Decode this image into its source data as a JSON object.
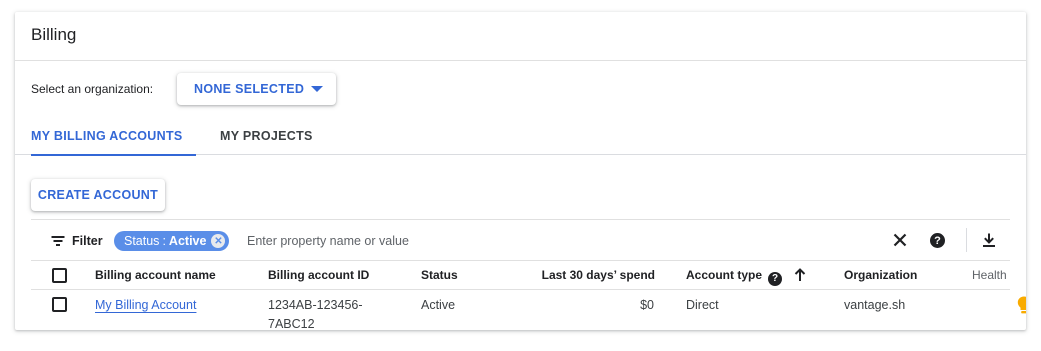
{
  "header": {
    "title": "Billing"
  },
  "org_select": {
    "label": "Select an organization:",
    "value": "NONE SELECTED"
  },
  "tabs": [
    {
      "label": "MY BILLING ACCOUNTS",
      "active": true
    },
    {
      "label": "MY PROJECTS",
      "active": false
    }
  ],
  "create_button": {
    "label": "CREATE ACCOUNT"
  },
  "filter": {
    "label": "Filter",
    "chip": {
      "key": "Status",
      "separator": ":",
      "value": "Active"
    },
    "placeholder": "Enter property name or value"
  },
  "table": {
    "columns": [
      "Billing account name",
      "Billing account ID",
      "Status",
      "Last 30 days’ spend",
      "Account type",
      "Organization",
      "Health"
    ],
    "rows": [
      {
        "name": "My Billing Account",
        "id_line1": "1234AB-123456-",
        "id_line2": "7ABC12",
        "status": "Active",
        "spend": "$0",
        "account_type": "Direct",
        "organization": "vantage.sh"
      }
    ]
  },
  "colors": {
    "accent": "#3367d6",
    "chip_bg": "#5a8ee8",
    "health_bulb": "#f9ab00"
  },
  "icons": [
    "filter-icon",
    "close-icon",
    "help-icon",
    "download-icon",
    "sort-up-arrow-icon",
    "lightbulb-icon",
    "dropdown-caret-icon"
  ]
}
